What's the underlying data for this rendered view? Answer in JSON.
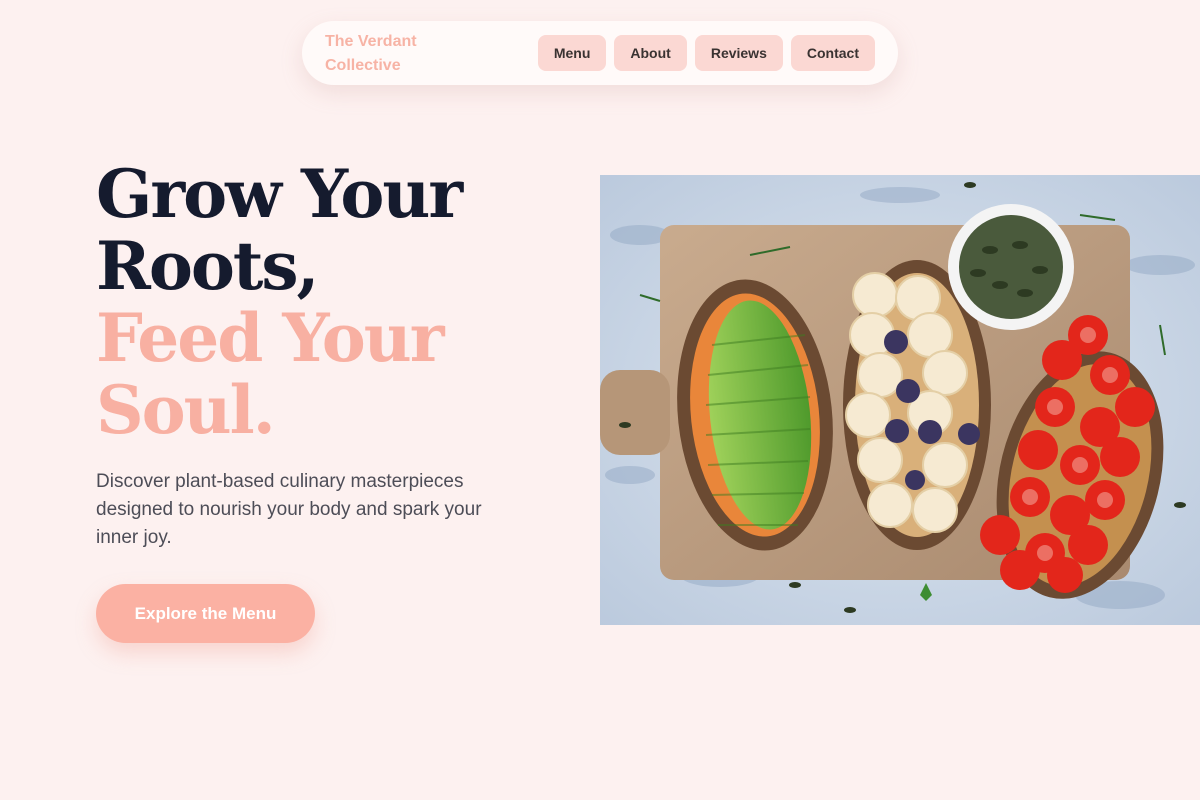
{
  "nav": {
    "brand": "The Verdant Collective",
    "links": [
      "Menu",
      "About",
      "Reviews",
      "Contact"
    ]
  },
  "hero": {
    "headline_dark_1": "Grow Your",
    "headline_dark_2": "Roots,",
    "headline_accent_1": "Feed Your",
    "headline_accent_2": "Soul.",
    "subtext": "Discover plant-based culinary masterpieces designed to nourish your body and spark your inner joy.",
    "cta_label": "Explore the Menu"
  },
  "colors": {
    "background": "#fdf1f0",
    "accent": "#f8b0a2",
    "nav_button": "#fbd8d3",
    "headline_dark": "#151b2e"
  }
}
